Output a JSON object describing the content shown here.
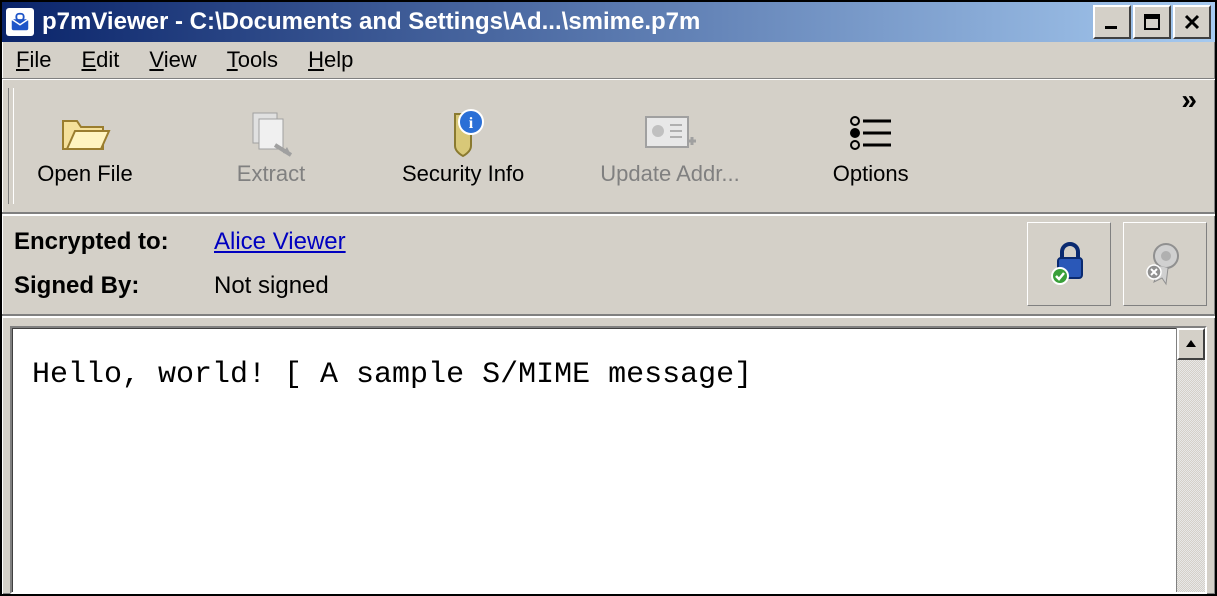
{
  "title": "p7mViewer - C:\\Documents and Settings\\Ad...\\smime.p7m",
  "menu": {
    "file": "File",
    "edit": "Edit",
    "view": "View",
    "tools": "Tools",
    "help": "Help"
  },
  "toolbar": {
    "open_file": "Open File",
    "extract": "Extract",
    "security_info": "Security Info",
    "update_addr": "Update Addr...",
    "options": "Options",
    "overflow": "»"
  },
  "info": {
    "encrypted_to_label": "Encrypted to:",
    "encrypted_to_value": "Alice Viewer",
    "signed_by_label": "Signed By:",
    "signed_by_value": "Not signed"
  },
  "icons": {
    "app": "lock-mail-icon",
    "open_file": "folder-open-icon",
    "extract": "extract-pages-icon",
    "security_info": "shield-info-icon",
    "update_addr": "contact-card-add-icon",
    "options": "options-sliders-icon",
    "encrypted_status": "lock-ok-icon",
    "signed_status": "ribbon-grey-icon"
  },
  "content": {
    "body": "Hello, world! [ A sample S/MIME message]"
  }
}
